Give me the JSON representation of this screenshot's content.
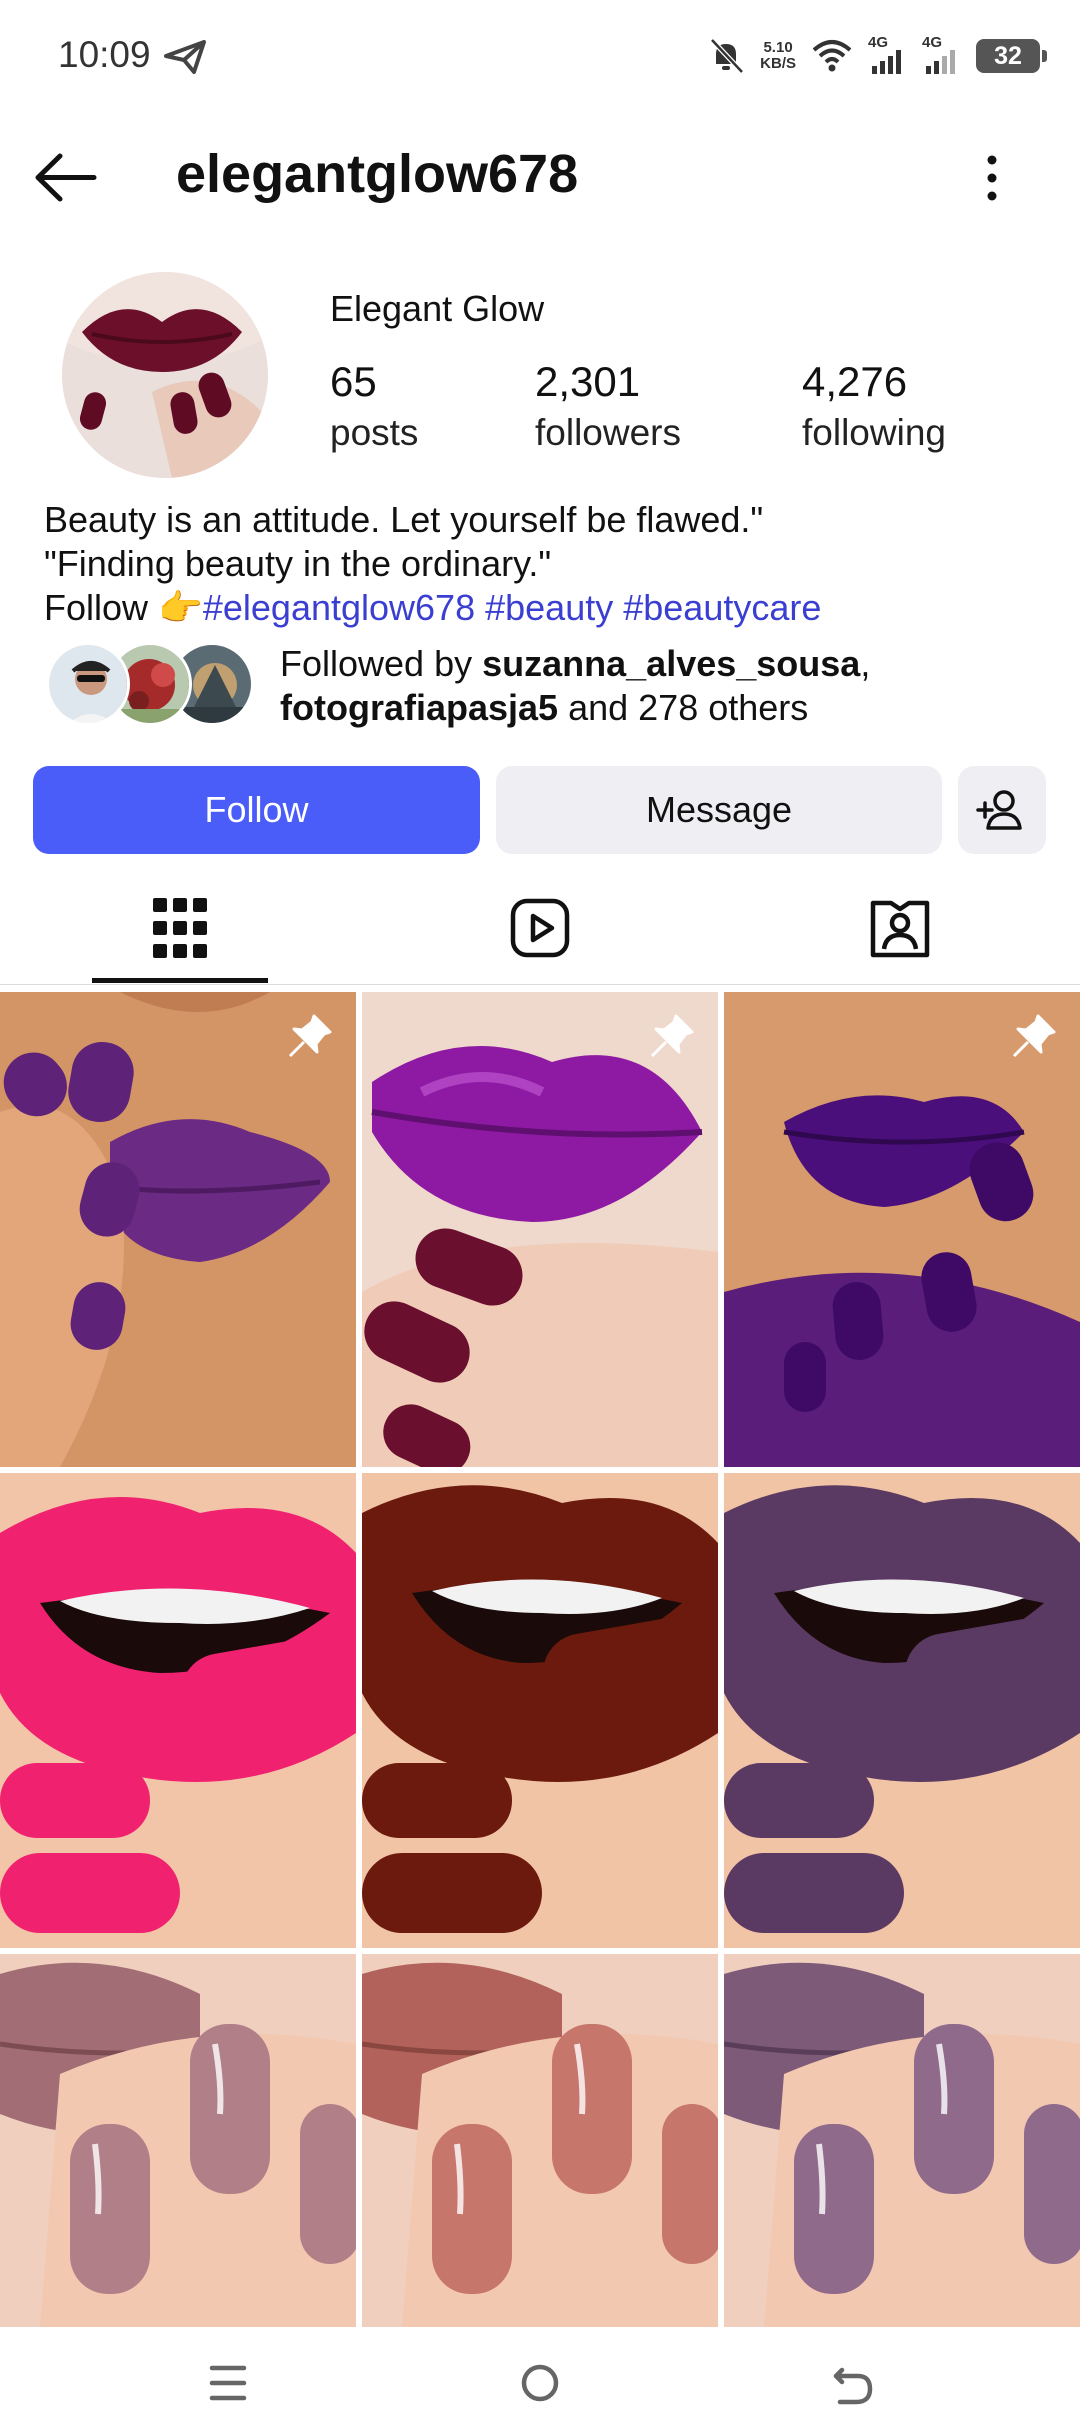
{
  "status_bar": {
    "time": "10:09",
    "speed_value": "5.10",
    "speed_unit": "KB/S",
    "network1": "4G",
    "network2": "4G",
    "battery": "32"
  },
  "header": {
    "username": "elegantglow678"
  },
  "profile": {
    "display_name": "Elegant Glow",
    "posts_count": "65",
    "posts_label": "posts",
    "followers_count": "2,301",
    "followers_label": "followers",
    "following_count": "4,276",
    "following_label": "following",
    "bio_line1": "Beauty is an attitude. Let yourself be flawed.\"",
    "bio_line2": "\"Finding beauty in the ordinary.\"",
    "bio_line3_prefix": "Follow 👉",
    "hashtags": [
      "#elegantglow678",
      "#beauty",
      "#beautycare"
    ],
    "followed_by_prefix": "Followed by ",
    "followed_user1": "suzanna_alves_sousa",
    "followed_sep": ",",
    "followed_user2": "fotografiapasja5",
    "followed_suffix": " and 278 others"
  },
  "actions": {
    "follow_label": "Follow",
    "message_label": "Message"
  },
  "tabs": [
    {
      "icon": "grid-icon",
      "selected": true
    },
    {
      "icon": "reels-icon",
      "selected": false
    },
    {
      "icon": "tagged-icon",
      "selected": false
    }
  ],
  "colors": {
    "accent": "#4a5df9",
    "hashtag": "#3b3fd1"
  }
}
